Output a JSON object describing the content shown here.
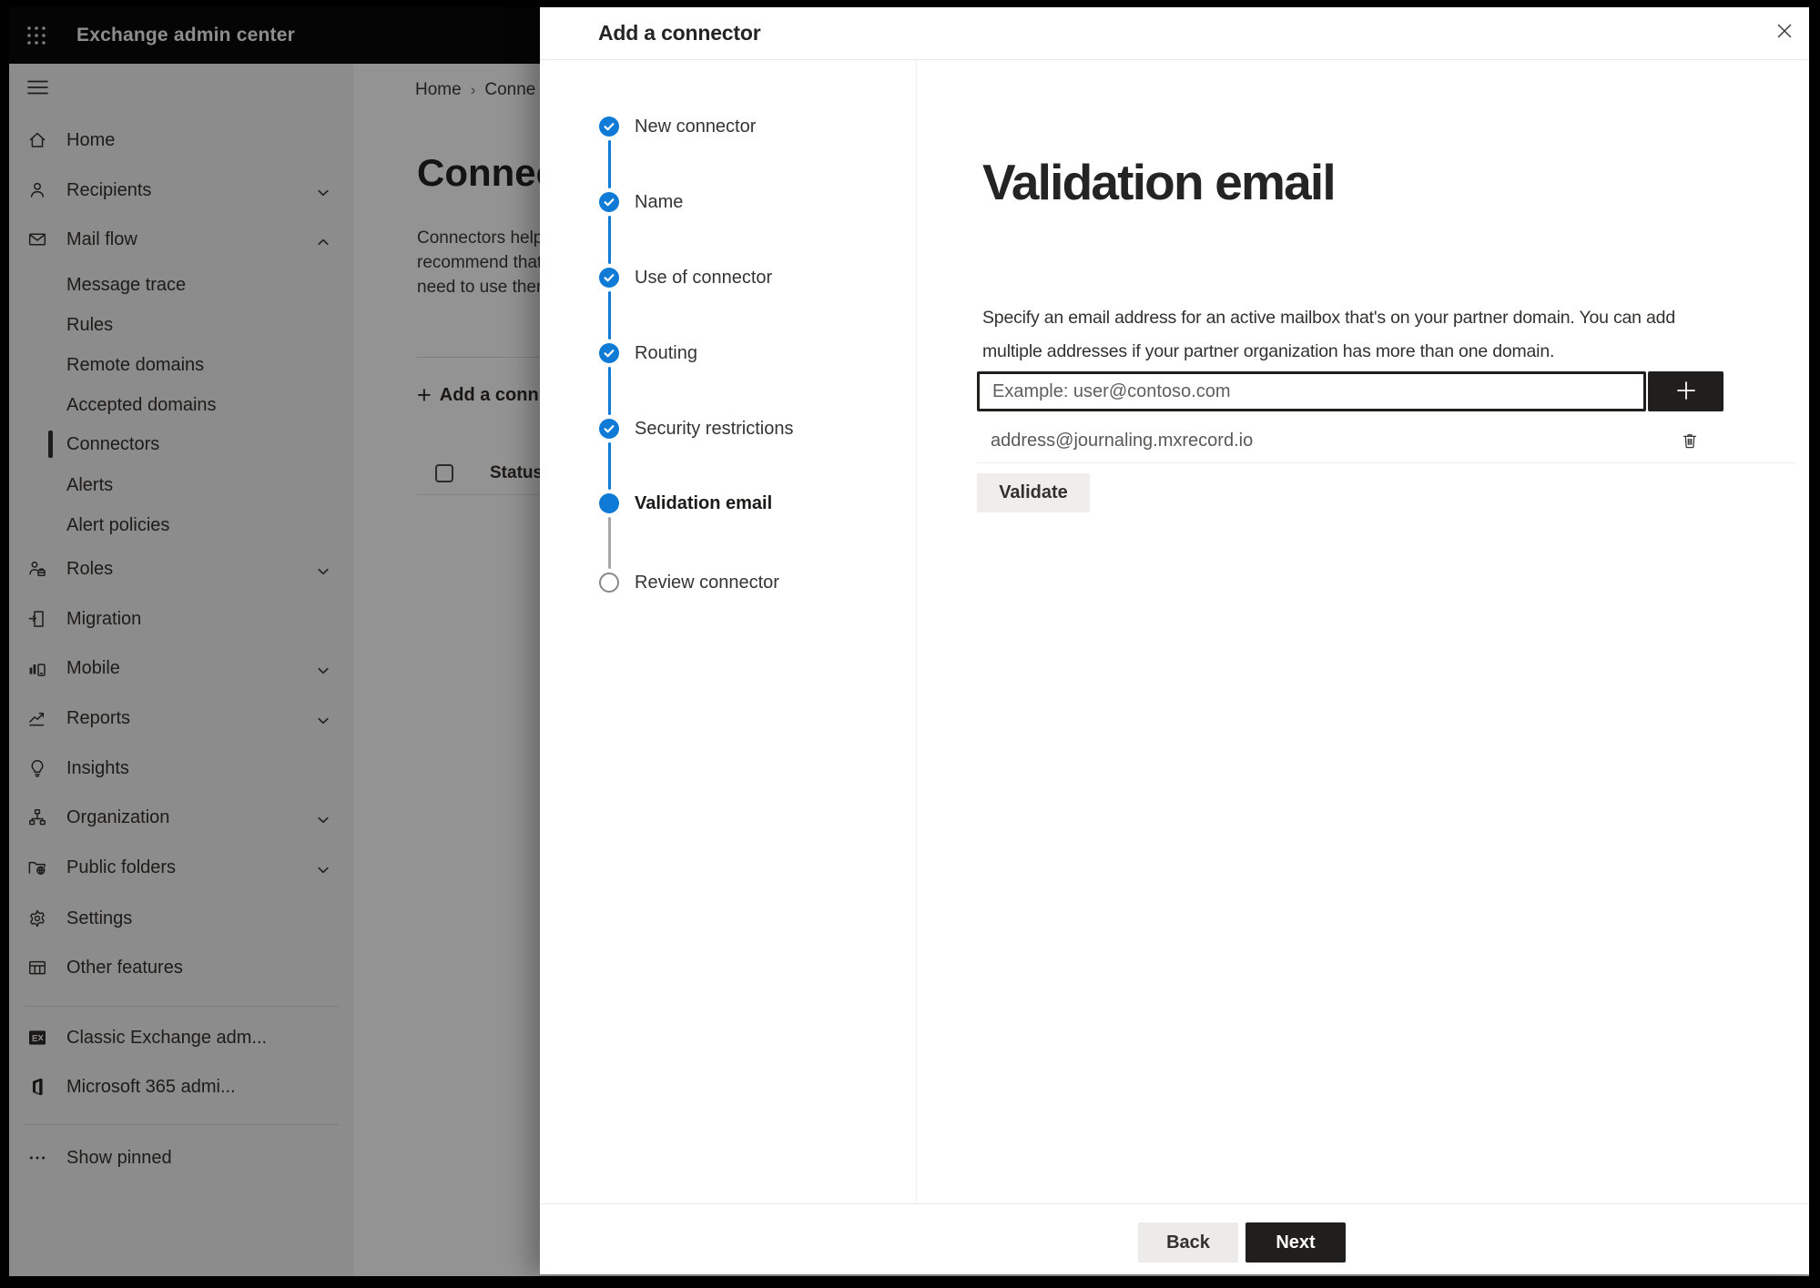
{
  "colors": {
    "accent_blue": "#0f7bd7",
    "header_bg": "#0a0a0a",
    "dark_button_bg": "#201f1e",
    "overlay_color": "rgba(0,0,0,0.42)",
    "selected_indicator": "#323130",
    "step_upcoming_border": "#8a8886"
  },
  "app_header": {
    "title": "Exchange admin center",
    "apps_icon": "waffle-icon"
  },
  "sidebar": {
    "menu_icon": "hamburger-icon",
    "items": [
      {
        "label": "Home",
        "slug": "home",
        "icon": "home-icon",
        "type": "top"
      },
      {
        "label": "Recipients",
        "slug": "recipients",
        "icon": "person-icon",
        "type": "top",
        "chevron": "down"
      },
      {
        "label": "Mail flow",
        "slug": "mail-flow",
        "icon": "mail-icon",
        "type": "top",
        "chevron": "up"
      },
      {
        "label": "Message trace",
        "slug": "message-trace",
        "type": "sub"
      },
      {
        "label": "Rules",
        "slug": "rules",
        "type": "sub"
      },
      {
        "label": "Remote domains",
        "slug": "remote-domains",
        "type": "sub"
      },
      {
        "label": "Accepted domains",
        "slug": "accepted-domains",
        "type": "sub"
      },
      {
        "label": "Connectors",
        "slug": "connectors",
        "type": "sub",
        "selected": true
      },
      {
        "label": "Alerts",
        "slug": "alerts",
        "type": "sub"
      },
      {
        "label": "Alert policies",
        "slug": "alert-policies",
        "type": "sub"
      },
      {
        "label": "Roles",
        "slug": "roles",
        "icon": "roles-icon",
        "type": "top",
        "chevron": "down"
      },
      {
        "label": "Migration",
        "slug": "migration",
        "icon": "migration-icon",
        "type": "top"
      },
      {
        "label": "Mobile",
        "slug": "mobile",
        "icon": "mobile-icon",
        "type": "top",
        "chevron": "down"
      },
      {
        "label": "Reports",
        "slug": "reports",
        "icon": "reports-icon",
        "type": "top",
        "chevron": "down"
      },
      {
        "label": "Insights",
        "slug": "insights",
        "icon": "insights-icon",
        "type": "top"
      },
      {
        "label": "Organization",
        "slug": "organization",
        "icon": "organization-icon",
        "type": "top",
        "chevron": "down"
      },
      {
        "label": "Public folders",
        "slug": "public-folders",
        "icon": "public-folders-icon",
        "type": "top",
        "chevron": "down"
      },
      {
        "label": "Settings",
        "slug": "settings",
        "icon": "settings-icon",
        "type": "top"
      },
      {
        "label": "Other features",
        "slug": "other-features",
        "icon": "other-features-icon",
        "type": "top"
      },
      {
        "type": "divider"
      },
      {
        "label": "Classic Exchange adm...",
        "slug": "classic-exchange-admin",
        "icon": "classic-exchange-icon",
        "type": "top"
      },
      {
        "label": "Microsoft 365 admi...",
        "slug": "microsoft-365-admin",
        "icon": "microsoft-365-icon",
        "type": "top"
      },
      {
        "type": "divider"
      },
      {
        "label": "Show pinned",
        "slug": "show-pinned",
        "icon": "ellipsis-icon",
        "type": "top"
      }
    ]
  },
  "page": {
    "breadcrumb": {
      "home": "Home",
      "separator": "›",
      "current": "Conne"
    },
    "title": "Connect",
    "description_lines": [
      "Connectors help",
      "recommend that",
      "need to use ther"
    ],
    "toolbar": {
      "add_icon": "plus-icon",
      "add_label": "Add a conn"
    },
    "table": {
      "status_header": "Status",
      "checkbox": "select-all-checkbox"
    }
  },
  "modal": {
    "title": "Add a connector",
    "close_icon": "close-icon",
    "steps": [
      {
        "label": "New connector",
        "state": "completed"
      },
      {
        "label": "Name",
        "state": "completed"
      },
      {
        "label": "Use of connector",
        "state": "completed"
      },
      {
        "label": "Routing",
        "state": "completed"
      },
      {
        "label": "Security restrictions",
        "state": "completed"
      },
      {
        "label": "Validation email",
        "state": "current"
      },
      {
        "label": "Review connector",
        "state": "upcoming"
      }
    ],
    "content": {
      "heading": "Validation email",
      "description_line1": "Specify an email address for an active mailbox that's on your partner domain. You can add",
      "description_line2": "multiple addresses if your partner organization has more than one domain.",
      "email_input": {
        "placeholder": "Example: user@contoso.com",
        "value": ""
      },
      "add_address_icon": "plus-icon",
      "addresses": [
        {
          "email": "address@journaling.mxrecord.io",
          "delete_icon": "trash-icon"
        }
      ],
      "validate_button": "Validate"
    },
    "footer": {
      "back_button": "Back",
      "next_button": "Next"
    }
  }
}
